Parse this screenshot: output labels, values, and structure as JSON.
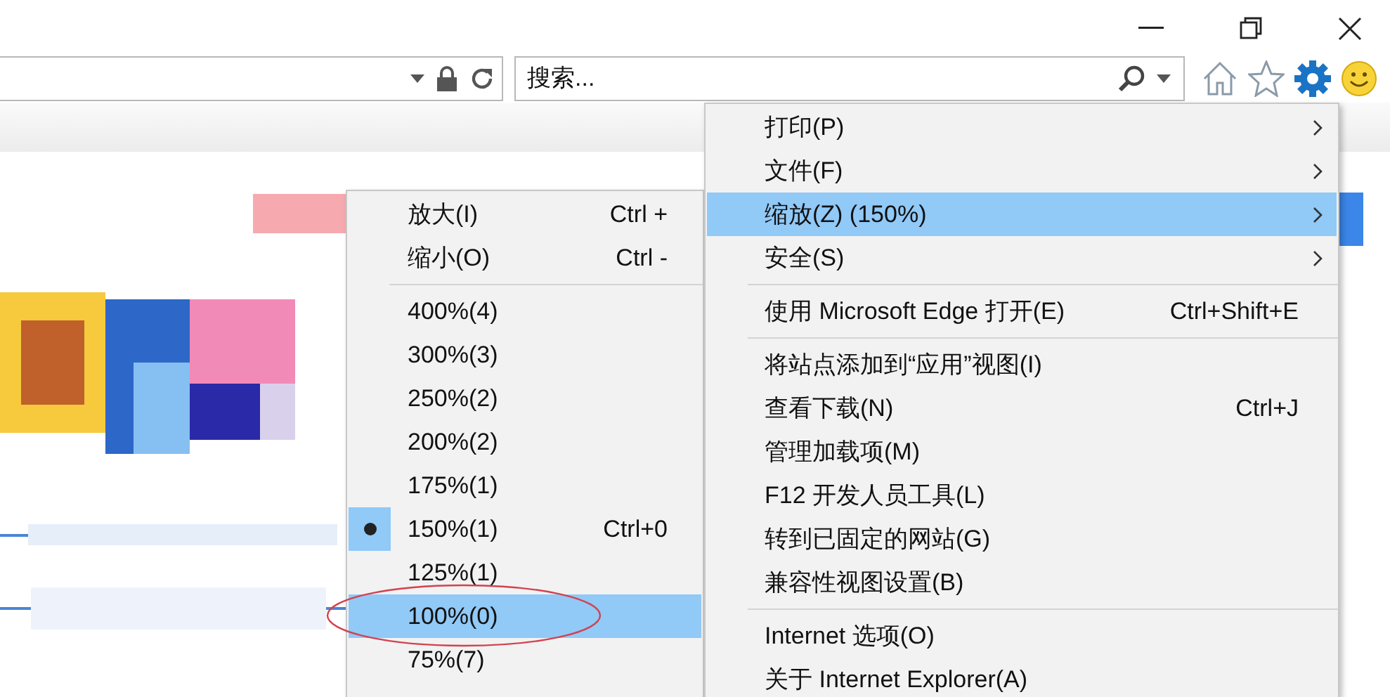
{
  "search": {
    "placeholder": "搜索..."
  },
  "main_menu": [
    {
      "kind": "item",
      "label": "打印(P)",
      "submenu": true,
      "selected": false
    },
    {
      "kind": "item",
      "label": "文件(F)",
      "submenu": true,
      "selected": false
    },
    {
      "kind": "item",
      "label": "缩放(Z) (150%)",
      "submenu": true,
      "selected": true
    },
    {
      "kind": "item",
      "label": "安全(S)",
      "submenu": true,
      "selected": false
    },
    {
      "kind": "separator"
    },
    {
      "kind": "item",
      "label": "使用 Microsoft Edge 打开(E)",
      "shortcut": "Ctrl+Shift+E",
      "submenu": false,
      "selected": false
    },
    {
      "kind": "separator"
    },
    {
      "kind": "item",
      "label": "将站点添加到“应用”视图(I)",
      "submenu": false,
      "selected": false
    },
    {
      "kind": "item",
      "label": "查看下载(N)",
      "shortcut": "Ctrl+J",
      "submenu": false,
      "selected": false
    },
    {
      "kind": "item",
      "label": "管理加载项(M)",
      "submenu": false,
      "selected": false
    },
    {
      "kind": "item",
      "label": "F12 开发人员工具(L)",
      "submenu": false,
      "selected": false
    },
    {
      "kind": "item",
      "label": "转到已固定的网站(G)",
      "submenu": false,
      "selected": false
    },
    {
      "kind": "item",
      "label": "兼容性视图设置(B)",
      "submenu": false,
      "selected": false
    },
    {
      "kind": "separator"
    },
    {
      "kind": "item",
      "label": "Internet 选项(O)",
      "submenu": false,
      "selected": false
    },
    {
      "kind": "item",
      "label": "关于 Internet Explorer(A)",
      "submenu": false,
      "selected": false
    }
  ],
  "zoom_menu": [
    {
      "kind": "item",
      "label": "放大(I)",
      "shortcut": "Ctrl +",
      "checked": false,
      "selected": false
    },
    {
      "kind": "item",
      "label": "缩小(O)",
      "shortcut": "Ctrl -",
      "checked": false,
      "selected": false
    },
    {
      "kind": "separator"
    },
    {
      "kind": "item",
      "label": "400%(4)",
      "checked": false,
      "selected": false
    },
    {
      "kind": "item",
      "label": "300%(3)",
      "checked": false,
      "selected": false
    },
    {
      "kind": "item",
      "label": "250%(2)",
      "checked": false,
      "selected": false
    },
    {
      "kind": "item",
      "label": "200%(2)",
      "checked": false,
      "selected": false
    },
    {
      "kind": "item",
      "label": "175%(1)",
      "checked": false,
      "selected": false
    },
    {
      "kind": "item",
      "label": "150%(1)",
      "shortcut": "Ctrl+0",
      "checked": true,
      "selected": false
    },
    {
      "kind": "item",
      "label": "125%(1)",
      "checked": false,
      "selected": false
    },
    {
      "kind": "item",
      "label": "100%(0)",
      "checked": false,
      "selected": true
    },
    {
      "kind": "item",
      "label": "75%(7)",
      "checked": false,
      "selected": false
    }
  ]
}
